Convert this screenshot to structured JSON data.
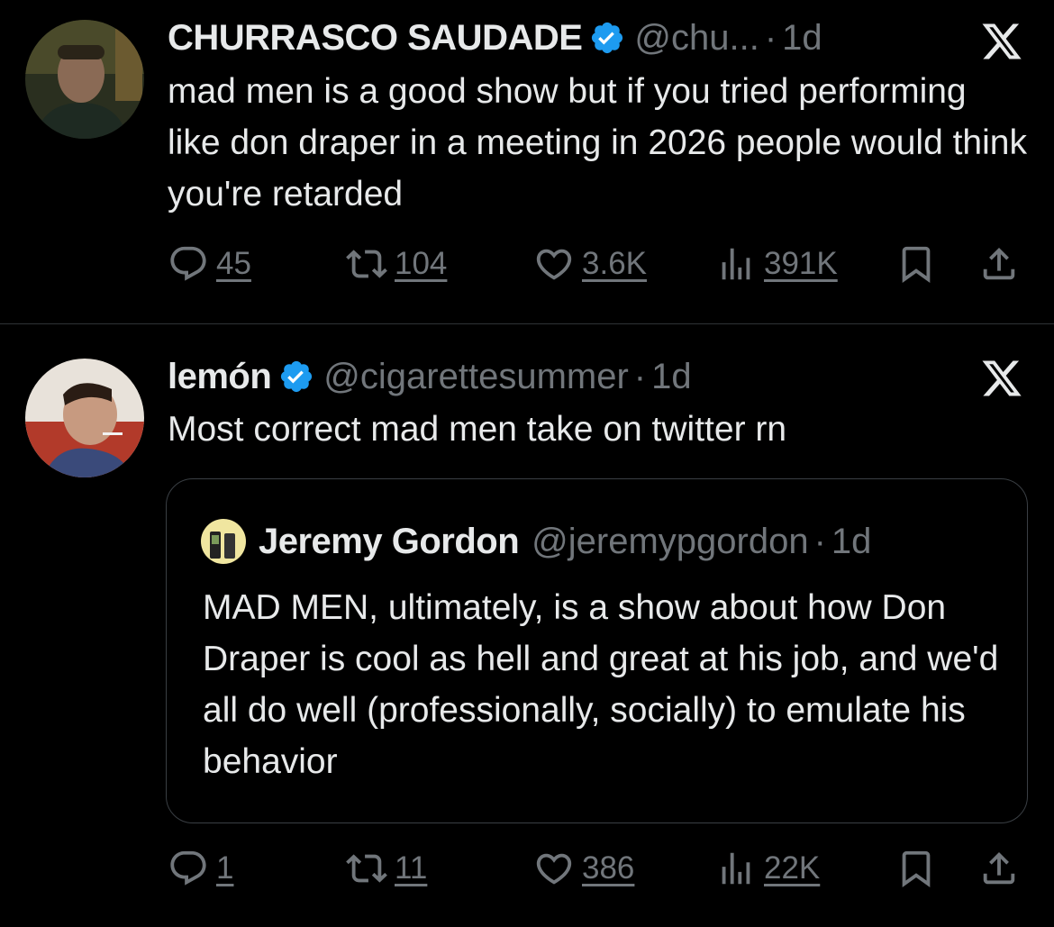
{
  "tweets": [
    {
      "name": "CHURRASCO SAUDADE",
      "handle": "@chu...",
      "dot": "·",
      "time": "1d",
      "text": "mad men is a good show but if you tried performing like don draper in a meeting in 2026 people would think you're retarded",
      "replies": "45",
      "retweets": "104",
      "likes": "3.6K",
      "views": "391K"
    },
    {
      "name": "lemón",
      "handle": "@cigarettesummer",
      "dot": "·",
      "time": "1d",
      "text": "Most correct mad men take on twitter rn",
      "replies": "1",
      "retweets": "11",
      "likes": "386",
      "views": "22K",
      "quote": {
        "name": "Jeremy Gordon",
        "handle": "@jeremypgordon",
        "dot": "·",
        "time": "1d",
        "text": "MAD MEN, ultimately, is a show about how Don Draper is cool as hell and great at his job, and we'd all do well (professionally, socially) to emulate his behavior"
      }
    }
  ],
  "icons": {
    "verified": "verified-badge-icon",
    "close": "x-logo-icon",
    "reply": "reply-icon",
    "retweet": "retweet-icon",
    "like": "heart-icon",
    "views": "views-icon",
    "bookmark": "bookmark-icon",
    "share": "share-icon"
  },
  "colors": {
    "background": "#000000",
    "text": "#e7e9ea",
    "muted": "#71767b",
    "verified": "#1d9bf0",
    "border": "#2f3336"
  }
}
